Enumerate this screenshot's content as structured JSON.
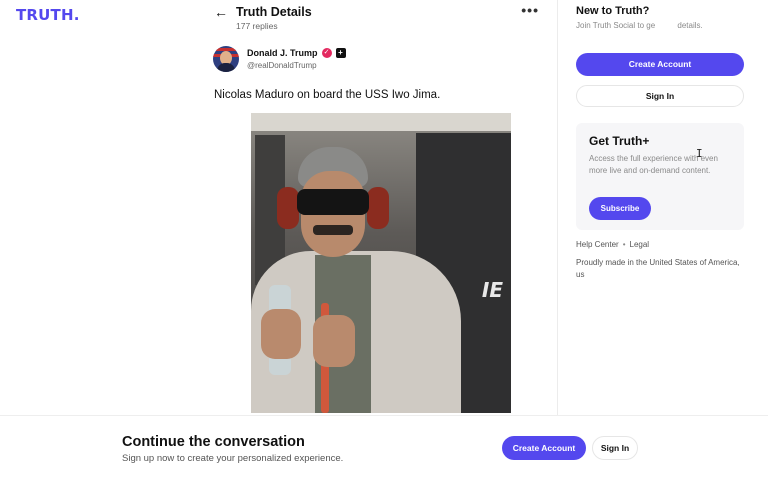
{
  "brand": {
    "logo_text": "TRUTH",
    "logo_dot": ".",
    "accent_color": "#5448ee"
  },
  "detail": {
    "back_icon": "arrow-left-icon",
    "title": "Truth Details",
    "replies": "177 replies",
    "more_icon": "more-horizontal-icon",
    "more_glyph": "•••"
  },
  "post": {
    "author_name": "Donald J. Trump",
    "author_handle": "@realDonaldTrump",
    "verified_icon": "verified-badge-icon",
    "plus_badge": "+",
    "text": "Nicolas Maduro on board the USS Iwo Jima.",
    "image_mark": "IE"
  },
  "sidebar": {
    "new_title": "New to Truth?",
    "new_desc": "Join Truth Social to ge          details.",
    "create_account": "Create Account",
    "sign_in": "Sign In",
    "plus_title": "Get Truth+",
    "plus_desc": "Access the full experience with even more live and on-demand content.",
    "subscribe": "Subscribe",
    "help_center": "Help Center",
    "legal": "Legal",
    "separator": "•",
    "made_in": "Proudly made in the United States of America, us"
  },
  "bottom": {
    "title": "Continue the conversation",
    "subtitle": "Sign up now to create your personalized experience.",
    "create_account": "Create Account",
    "sign_in": "Sign In"
  }
}
